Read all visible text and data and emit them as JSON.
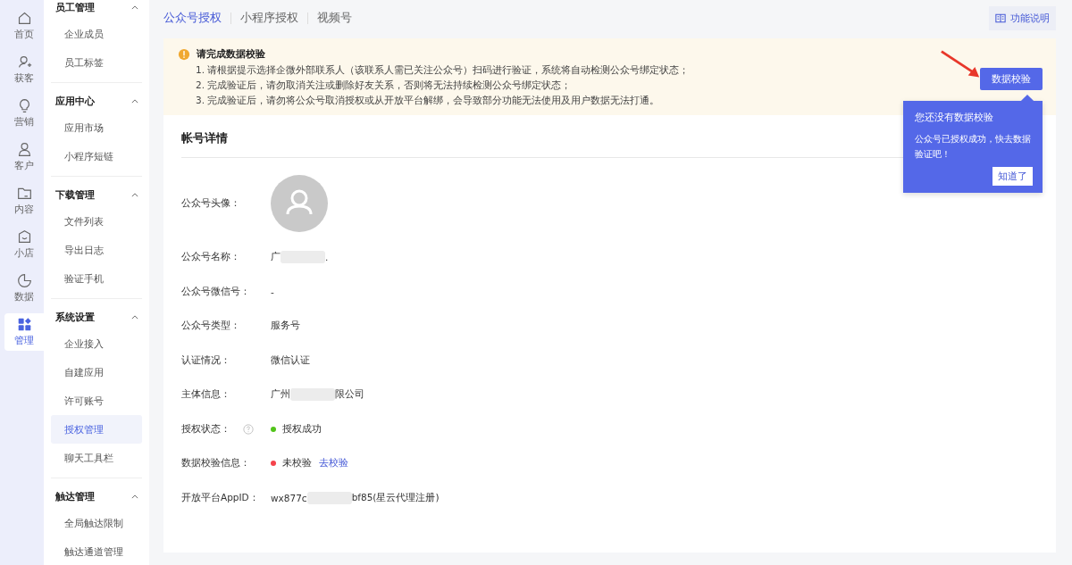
{
  "rail": [
    {
      "label": "首页",
      "selected": false
    },
    {
      "label": "获客",
      "selected": false
    },
    {
      "label": "营销",
      "selected": false
    },
    {
      "label": "客户",
      "selected": false
    },
    {
      "label": "内容",
      "selected": false
    },
    {
      "label": "小店",
      "selected": false
    },
    {
      "label": "数据",
      "selected": false
    },
    {
      "label": "管理",
      "selected": true
    }
  ],
  "menu": [
    {
      "title": "员工管理",
      "expanded": true,
      "items": [
        {
          "label": "企业成员",
          "selected": false
        },
        {
          "label": "员工标签",
          "selected": false
        }
      ]
    },
    {
      "title": "应用中心",
      "expanded": true,
      "items": [
        {
          "label": "应用市场",
          "selected": false
        },
        {
          "label": "小程序短链",
          "selected": false
        }
      ]
    },
    {
      "title": "下载管理",
      "expanded": true,
      "items": [
        {
          "label": "文件列表",
          "selected": false
        },
        {
          "label": "导出日志",
          "selected": false
        },
        {
          "label": "验证手机",
          "selected": false
        }
      ]
    },
    {
      "title": "系统设置",
      "expanded": true,
      "items": [
        {
          "label": "企业接入",
          "selected": false
        },
        {
          "label": "自建应用",
          "selected": false
        },
        {
          "label": "许可账号",
          "selected": false
        },
        {
          "label": "授权管理",
          "selected": true
        },
        {
          "label": "聊天工具栏",
          "selected": false
        }
      ]
    },
    {
      "title": "触达管理",
      "expanded": true,
      "items": [
        {
          "label": "全局触达限制",
          "selected": false
        },
        {
          "label": "触达通道管理",
          "selected": false
        }
      ]
    }
  ],
  "tabs": [
    {
      "label": "公众号授权",
      "selected": true
    },
    {
      "label": "小程序授权",
      "selected": false
    },
    {
      "label": "视频号",
      "selected": false
    }
  ],
  "help_button": "功能说明",
  "notice": {
    "title": "请完成数据校验",
    "lines": [
      "1. 请根据提示选择企微外部联系人（该联系人需已关注公众号）扫码进行验证，系统将自动检测公众号绑定状态；",
      "2. 完成验证后，请勿取消关注或删除好友关系，否则将无法持续检测公众号绑定状态；",
      "3. 完成验证后，请勿将公众号取消授权或从开放平台解绑，会导致部分功能无法使用及用户数据无法打通。"
    ],
    "button": "数据校验"
  },
  "popover": {
    "title": "您还没有数据校验",
    "body": "公众号已授权成功，快去数据验证吧！",
    "button": "知道了"
  },
  "card": {
    "title": "帐号详情",
    "fields": [
      {
        "kind": "avatar",
        "label": "公众号头像："
      },
      {
        "kind": "text",
        "label": "公众号名称：",
        "segments": [
          "广",
          "."
        ]
      },
      {
        "kind": "text",
        "label": "公众号微信号：",
        "segments": [
          "-"
        ]
      },
      {
        "kind": "text",
        "label": "公众号类型：",
        "segments": [
          "服务号"
        ]
      },
      {
        "kind": "text",
        "label": "认证情况：",
        "segments": [
          "微信认证"
        ]
      },
      {
        "kind": "text",
        "label": "主体信息：",
        "segments": [
          "广州",
          "限公司"
        ]
      },
      {
        "kind": "status",
        "label": "授权状态：",
        "help": true,
        "status": "授权成功",
        "color": "#52c41a"
      },
      {
        "kind": "status",
        "label": "数据校验信息：",
        "help": false,
        "status": "未校验",
        "color": "#f5424b",
        "link": "去校验"
      },
      {
        "kind": "text",
        "label": "开放平台AppID：",
        "segments": [
          "wx877c",
          "bf85(星云代理注册)"
        ]
      }
    ]
  }
}
